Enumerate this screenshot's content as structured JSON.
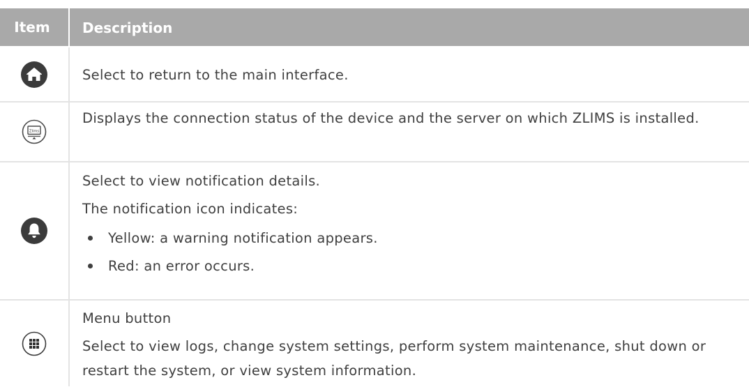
{
  "table": {
    "headers": {
      "item": "Item",
      "description": "Description"
    },
    "colors": {
      "header_bg": "#a9a9a9",
      "header_text": "#ffffff",
      "body_text": "#3f3f3f",
      "icon_dark": "#3b3b3b",
      "rule": "#e3e3e3"
    },
    "rows": [
      {
        "icon": "home-icon",
        "lines": [
          "Select to return to the main interface."
        ]
      },
      {
        "icon": "zlims-connection-icon",
        "icon_label": "Zlims",
        "lines": [
          "Displays the connection status of the device and the server on which ZLIMS is installed."
        ]
      },
      {
        "icon": "notification-bell-icon",
        "lines": [
          "Select to view notification details.",
          "The notification icon indicates:"
        ],
        "bullets": [
          "Yellow: a warning notification appears.",
          "Red: an error occurs."
        ]
      },
      {
        "icon": "menu-grid-icon",
        "lines": [
          "Menu button",
          "Select to view logs, change system settings, perform system maintenance, shut down or restart the system, or view system information."
        ]
      }
    ]
  }
}
